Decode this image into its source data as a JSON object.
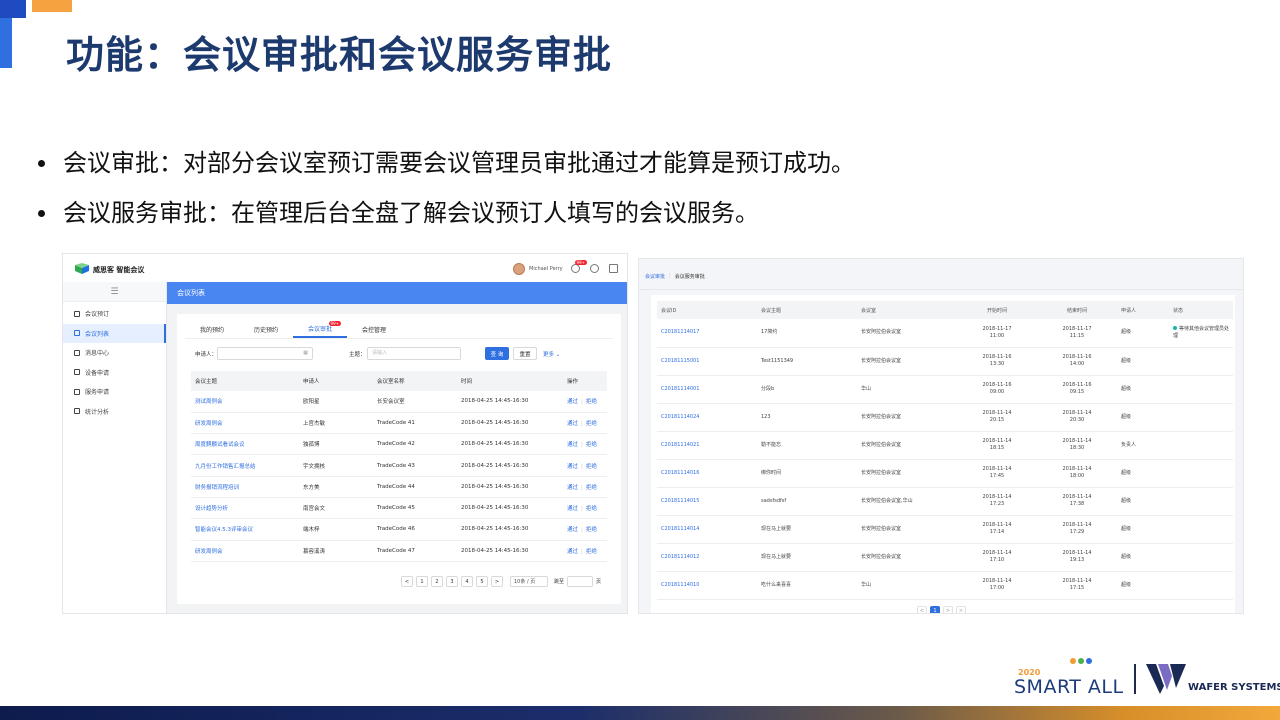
{
  "title": "功能：会议审批和会议服务审批",
  "bullets": [
    "会议审批：对部分会议室预订需要会议管理员审批通过才能算是预订成功。",
    "会议服务审批：在管理后台全盘了解会议预订人填写的会议服务。"
  ],
  "shot1": {
    "brand": "威思客 智能会议",
    "user_name": "Michael Perry",
    "notif_count": "99+",
    "menu_toggle": "☰",
    "nav": [
      {
        "label": "会议预订"
      },
      {
        "label": "会议列表",
        "active": true
      },
      {
        "label": "消息中心"
      },
      {
        "label": "设备申请"
      },
      {
        "label": "服务申请"
      },
      {
        "label": "统计分析"
      }
    ],
    "header": "会议列表",
    "tabs": [
      {
        "label": "我的预约"
      },
      {
        "label": "历史预约"
      },
      {
        "label": "会议审批",
        "badge": "99+",
        "active": true
      },
      {
        "label": "会控管理"
      }
    ],
    "filter": {
      "applicant_label": "申请人：",
      "topic_label": "主题：",
      "topic_placeholder": "请输入",
      "search_btn": "查 询",
      "reset_btn": "重置",
      "more": "更多 ⌄"
    },
    "columns": [
      "会议主题",
      "申请人",
      "会议室名称",
      "时间",
      "操作"
    ],
    "rows": [
      {
        "topic": "测试周例会",
        "applicant": "欧阳星",
        "room": "长安会议室",
        "time": "2018-04-25  14:45-16:30"
      },
      {
        "topic": "研发周例会",
        "applicant": "上官杰敏",
        "room": "TradeCode 41",
        "time": "2018-04-25  14:45-16:30"
      },
      {
        "topic": "周度麒麟试看试会议",
        "applicant": "独孤博",
        "room": "TradeCode 42",
        "time": "2018-04-25  14:45-16:30"
      },
      {
        "topic": "九月份工作销售汇报总结",
        "applicant": "宇文拥核",
        "room": "TradeCode 43",
        "time": "2018-04-25  14:45-16:30"
      },
      {
        "topic": "财务报销流程培训",
        "applicant": "东方美",
        "room": "TradeCode 44",
        "time": "2018-04-25  14:45-16:30"
      },
      {
        "topic": "设计趋势分析",
        "applicant": "南宫会文",
        "room": "TradeCode 45",
        "time": "2018-04-25  14:45-16:30"
      },
      {
        "topic": "智能会议4.5.3评审会议",
        "applicant": "端木梓",
        "room": "TradeCode 46",
        "time": "2018-04-25  14:45-16:30"
      },
      {
        "topic": "研发周例会",
        "applicant": "慕容溪涛",
        "room": "TradeCode 47",
        "time": "2018-04-25  14:45-16:30"
      }
    ],
    "approve": "通过",
    "reject": "拒绝",
    "pager": {
      "prev": "<",
      "pages": [
        "1",
        "2",
        "3",
        "4",
        "5"
      ],
      "next": ">",
      "size": "10条 / 页",
      "jump_label": "跳至",
      "page_unit": "页"
    }
  },
  "shot2": {
    "crumb_1": "会议审批",
    "crumb_2": "会议服务审批",
    "columns": [
      "会议ID",
      "会议主题",
      "会议室",
      "开始时间",
      "结束时间",
      "申请人",
      "状态"
    ],
    "rows": [
      {
        "id": "C20181114017",
        "topic": "17简约",
        "room": "长安阿拉伯会议室",
        "start_date": "2018-11-17",
        "start_time": "11:00",
        "end_date": "2018-11-17",
        "end_time": "11:15",
        "applicant": "超级",
        "status": "等待其他会议管理员处理"
      },
      {
        "id": "C20181115001",
        "topic": "Test1151349",
        "room": "长安阿拉伯会议室",
        "start_date": "2018-11-16",
        "start_time": "13:30",
        "end_date": "2018-11-16",
        "end_time": "14:00",
        "applicant": "超级",
        "status": ""
      },
      {
        "id": "C20181114001",
        "topic": "分段b",
        "room": "华山",
        "start_date": "2018-11-16",
        "start_time": "09:00",
        "end_date": "2018-11-16",
        "end_time": "09:15",
        "applicant": "超级",
        "status": ""
      },
      {
        "id": "C20181114024",
        "topic": "123",
        "room": "长安阿拉伯会议室",
        "start_date": "2018-11-14",
        "start_time": "20:15",
        "end_date": "2018-11-14",
        "end_time": "20:30",
        "applicant": "超级",
        "status": ""
      },
      {
        "id": "C20181114021",
        "topic": "勒不能忘",
        "room": "长安阿拉伯会议室",
        "start_date": "2018-11-14",
        "start_time": "18:15",
        "end_date": "2018-11-14",
        "end_time": "18:30",
        "applicant": "负责人",
        "status": ""
      },
      {
        "id": "C20181114016",
        "topic": "绑你时间",
        "room": "长安阿拉伯会议室",
        "start_date": "2018-11-14",
        "start_time": "17:45",
        "end_date": "2018-11-14",
        "end_time": "18:00",
        "applicant": "超级",
        "status": ""
      },
      {
        "id": "C20181114015",
        "topic": "sadsfsdfsf",
        "room": "长安阿拉伯会议室,华山",
        "start_date": "2018-11-14",
        "start_time": "17:23",
        "end_date": "2018-11-14",
        "end_time": "17:38",
        "applicant": "超级",
        "status": ""
      },
      {
        "id": "C20181114014",
        "topic": "现在马上就要",
        "room": "长安阿拉伯会议室",
        "start_date": "2018-11-14",
        "start_time": "17:14",
        "end_date": "2018-11-14",
        "end_time": "17:29",
        "applicant": "超级",
        "status": ""
      },
      {
        "id": "C20181114012",
        "topic": "现在马上就要",
        "room": "长安阿拉伯会议室",
        "start_date": "2018-11-14",
        "start_time": "17:10",
        "end_date": "2018-11-14",
        "end_time": "19:13",
        "applicant": "超级",
        "status": ""
      },
      {
        "id": "C20181114010",
        "topic": "吃什么来喜喜",
        "room": "华山",
        "start_date": "2018-11-14",
        "start_time": "17:00",
        "end_date": "2018-11-14",
        "end_time": "17:15",
        "applicant": "超级",
        "status": ""
      }
    ],
    "pager": {
      "prev": "<",
      "current": "1",
      "next": ">",
      "last": ">"
    }
  },
  "footer": {
    "smart_year": "2020",
    "smart_text": "SMART ALL",
    "wafer_text": "WAFER SYSTEMS"
  },
  "colors": {
    "title": "#1d3a6e",
    "accent_blue": "#2f6fe0",
    "header_blue": "#4a86f2",
    "orange": "#f4a340",
    "status_teal": "#19b5a9"
  }
}
